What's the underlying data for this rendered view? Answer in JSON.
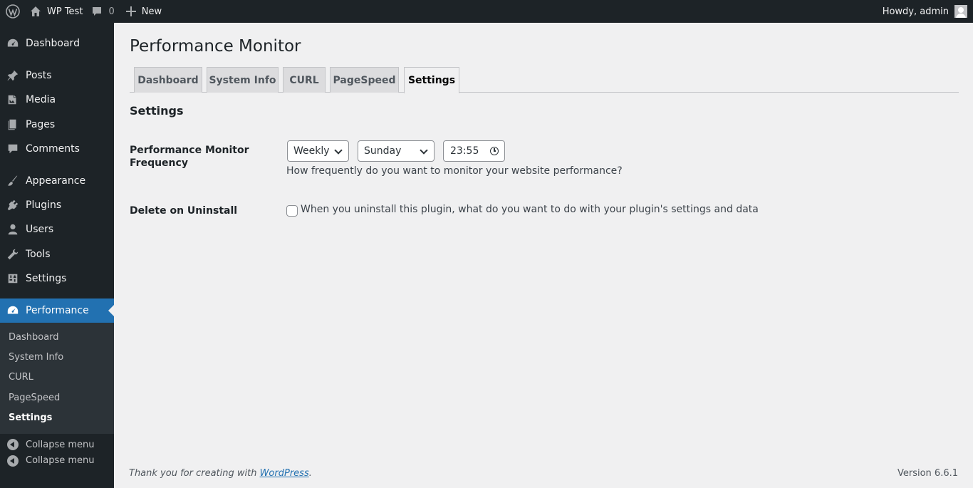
{
  "adminbar": {
    "site_name": "WP Test",
    "comments_count": "0",
    "new_label": "New",
    "howdy": "Howdy, admin"
  },
  "sidebar": {
    "items": [
      {
        "label": "Dashboard",
        "icon": "dashboard-icon"
      },
      {
        "label": "Posts",
        "icon": "pin-icon"
      },
      {
        "label": "Media",
        "icon": "media-icon"
      },
      {
        "label": "Pages",
        "icon": "pages-icon"
      },
      {
        "label": "Comments",
        "icon": "comment-icon"
      },
      {
        "label": "Appearance",
        "icon": "brush-icon"
      },
      {
        "label": "Plugins",
        "icon": "plug-icon"
      },
      {
        "label": "Users",
        "icon": "user-icon"
      },
      {
        "label": "Tools",
        "icon": "wrench-icon"
      },
      {
        "label": "Settings",
        "icon": "settings-icon"
      },
      {
        "label": "Performance",
        "icon": "gauge-icon"
      }
    ],
    "submenu": [
      "Dashboard",
      "System Info",
      "CURL",
      "PageSpeed",
      "Settings"
    ],
    "collapse_label": "Collapse menu"
  },
  "main": {
    "title": "Performance Monitor",
    "tabs": [
      "Dashboard",
      "System Info",
      "CURL",
      "PageSpeed",
      "Settings"
    ],
    "section_title": "Settings",
    "frequency": {
      "label": "Performance Monitor Frequency",
      "interval": "Weekly",
      "day": "Sunday",
      "time": "23:55",
      "description": "How frequently do you want to monitor your website performance?"
    },
    "uninstall": {
      "label": "Delete on Uninstall",
      "checkbox_label": "When you uninstall this plugin, what do you want to do with your plugin's settings and data",
      "checked": false
    }
  },
  "footer": {
    "thanks_prefix": "Thank you for creating with ",
    "wordpress_link": "WordPress",
    "thanks_suffix": ".",
    "version": "Version 6.6.1"
  },
  "colors": {
    "accent": "#2271b1",
    "adminbar_bg": "#1d2327",
    "page_bg": "#f0f0f1"
  }
}
